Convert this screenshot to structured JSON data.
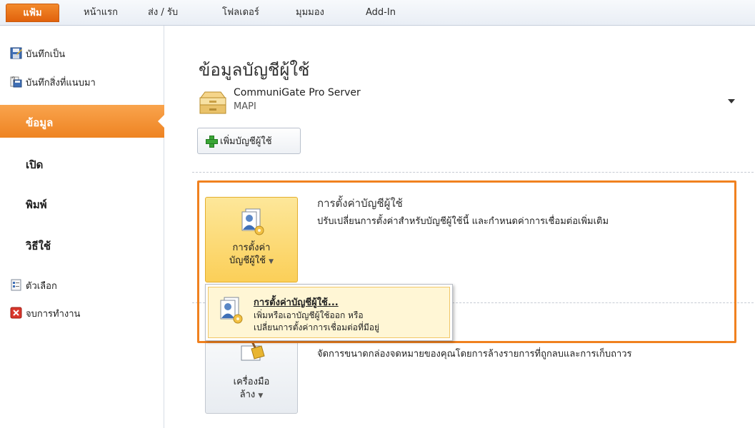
{
  "tabs": {
    "file": "แฟ้ม",
    "items": [
      "หน้าแรก",
      "ส่ง / รับ",
      "โฟลเดอร์",
      "มุมมอง",
      "Add-In"
    ]
  },
  "sidebar": {
    "commands": [
      "บันทึกเป็น",
      "บันทึกสิ่งที่แนบมา"
    ],
    "nav": [
      "ข้อมูล",
      "เปิด",
      "พิมพ์",
      "วิธีใช้"
    ],
    "selected": "ข้อมูล",
    "footer": [
      "ตัวเลือก",
      "จบการทำงาน"
    ]
  },
  "main": {
    "title": "ข้อมูลบัญชีผู้ใช้",
    "account": {
      "name": "CommuniGate Pro Server",
      "type": "MAPI"
    },
    "add_account": "เพิ่มบัญชีผู้ใช้",
    "account_settings": {
      "button_line1": "การตั้งค่า",
      "button_line2": "บัญชีผู้ใช้",
      "heading": "การตั้งค่าบัญชีผู้ใช้",
      "description": "ปรับเปลี่ยนการตั้งค่าสำหรับบัญชีผู้ใช้นี้ และกำหนดค่าการเชื่อมต่อเพิ่มเติม"
    },
    "dropdown": {
      "title": "การตั้งค่าบัญชีผู้ใช้...",
      "line1": "เพิ่มหรือเอาบัญชีผู้ใช้ออก หรือ",
      "line2": "เปลี่ยนการตั้งค่าการเชื่อมต่อที่มีอยู่"
    },
    "cleanup": {
      "button_line1": "เครื่องมือ",
      "button_line2": "ล้าง",
      "description": "จัดการขนาดกล่องจดหมายของคุณโดยการล้างรายการที่ถูกลบและการเก็บถาวร"
    }
  },
  "colors": {
    "accent": "#f0811f",
    "file_tab": "#e1620c",
    "hover": "#fbcf58"
  }
}
